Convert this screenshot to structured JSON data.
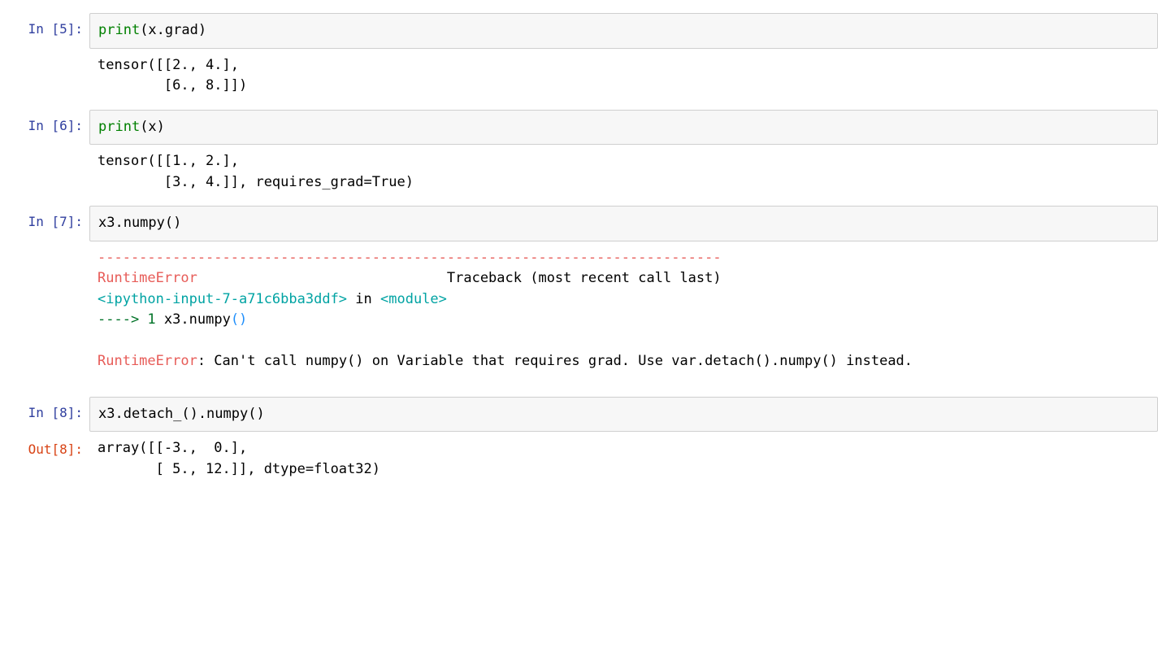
{
  "top_symbol": "",
  "cells": {
    "c5": {
      "prompt": "In [5]:",
      "code_fn": "print",
      "code_args": "(x.grad)",
      "output": "tensor([[2., 4.],\n        [6., 8.]])"
    },
    "c6": {
      "prompt": "In [6]:",
      "code_fn": "print",
      "code_args": "(x)",
      "output": "tensor([[1., 2.],\n        [3., 4.]], requires_grad=True)"
    },
    "c7": {
      "prompt": "In [7]:",
      "code": "x3.numpy()",
      "err_dashes": "---------------------------------------------------------------------------",
      "err_name1": "RuntimeError",
      "err_trace": "                              Traceback (most recent call last)",
      "err_loc": "<ipython-input-7-a71c6bba3ddf>",
      "err_in": " in ",
      "err_mod": "<module>",
      "err_arrow": "----> 1",
      "err_call_pre": " x3",
      "err_call_dot": ".",
      "err_call_fn": "numpy",
      "err_call_par": "()",
      "err_blank": "",
      "err_name2": "RuntimeError",
      "err_msg": ": Can't call numpy() on Variable that requires grad. Use var.detach().numpy() instead."
    },
    "c8": {
      "prompt_in": "In [8]:",
      "prompt_out": "Out[8]:",
      "code": "x3.detach_().numpy()",
      "output": "array([[-3.,  0.],\n       [ 5., 12.]], dtype=float32)"
    }
  }
}
